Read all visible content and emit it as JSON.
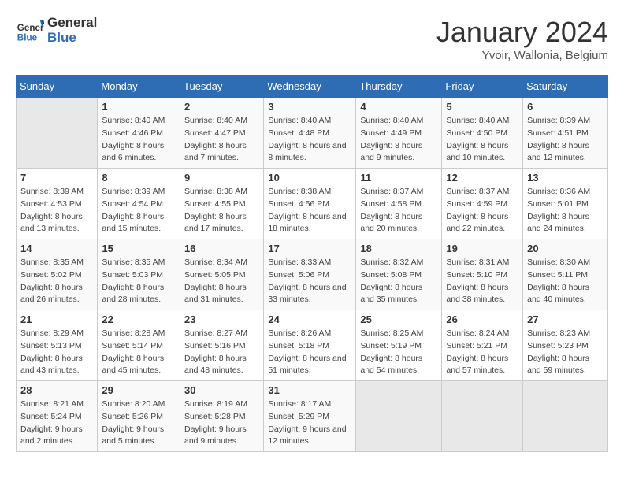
{
  "header": {
    "logo": {
      "general": "General",
      "blue": "Blue"
    },
    "title": "January 2024",
    "subtitle": "Yvoir, Wallonia, Belgium"
  },
  "weekdays": [
    "Sunday",
    "Monday",
    "Tuesday",
    "Wednesday",
    "Thursday",
    "Friday",
    "Saturday"
  ],
  "weeks": [
    [
      {
        "day": "",
        "empty": true
      },
      {
        "day": "1",
        "sunrise": "Sunrise: 8:40 AM",
        "sunset": "Sunset: 4:46 PM",
        "daylight": "Daylight: 8 hours and 6 minutes."
      },
      {
        "day": "2",
        "sunrise": "Sunrise: 8:40 AM",
        "sunset": "Sunset: 4:47 PM",
        "daylight": "Daylight: 8 hours and 7 minutes."
      },
      {
        "day": "3",
        "sunrise": "Sunrise: 8:40 AM",
        "sunset": "Sunset: 4:48 PM",
        "daylight": "Daylight: 8 hours and 8 minutes."
      },
      {
        "day": "4",
        "sunrise": "Sunrise: 8:40 AM",
        "sunset": "Sunset: 4:49 PM",
        "daylight": "Daylight: 8 hours and 9 minutes."
      },
      {
        "day": "5",
        "sunrise": "Sunrise: 8:40 AM",
        "sunset": "Sunset: 4:50 PM",
        "daylight": "Daylight: 8 hours and 10 minutes."
      },
      {
        "day": "6",
        "sunrise": "Sunrise: 8:39 AM",
        "sunset": "Sunset: 4:51 PM",
        "daylight": "Daylight: 8 hours and 12 minutes."
      }
    ],
    [
      {
        "day": "7",
        "sunrise": "Sunrise: 8:39 AM",
        "sunset": "Sunset: 4:53 PM",
        "daylight": "Daylight: 8 hours and 13 minutes."
      },
      {
        "day": "8",
        "sunrise": "Sunrise: 8:39 AM",
        "sunset": "Sunset: 4:54 PM",
        "daylight": "Daylight: 8 hours and 15 minutes."
      },
      {
        "day": "9",
        "sunrise": "Sunrise: 8:38 AM",
        "sunset": "Sunset: 4:55 PM",
        "daylight": "Daylight: 8 hours and 17 minutes."
      },
      {
        "day": "10",
        "sunrise": "Sunrise: 8:38 AM",
        "sunset": "Sunset: 4:56 PM",
        "daylight": "Daylight: 8 hours and 18 minutes."
      },
      {
        "day": "11",
        "sunrise": "Sunrise: 8:37 AM",
        "sunset": "Sunset: 4:58 PM",
        "daylight": "Daylight: 8 hours and 20 minutes."
      },
      {
        "day": "12",
        "sunrise": "Sunrise: 8:37 AM",
        "sunset": "Sunset: 4:59 PM",
        "daylight": "Daylight: 8 hours and 22 minutes."
      },
      {
        "day": "13",
        "sunrise": "Sunrise: 8:36 AM",
        "sunset": "Sunset: 5:01 PM",
        "daylight": "Daylight: 8 hours and 24 minutes."
      }
    ],
    [
      {
        "day": "14",
        "sunrise": "Sunrise: 8:35 AM",
        "sunset": "Sunset: 5:02 PM",
        "daylight": "Daylight: 8 hours and 26 minutes."
      },
      {
        "day": "15",
        "sunrise": "Sunrise: 8:35 AM",
        "sunset": "Sunset: 5:03 PM",
        "daylight": "Daylight: 8 hours and 28 minutes."
      },
      {
        "day": "16",
        "sunrise": "Sunrise: 8:34 AM",
        "sunset": "Sunset: 5:05 PM",
        "daylight": "Daylight: 8 hours and 31 minutes."
      },
      {
        "day": "17",
        "sunrise": "Sunrise: 8:33 AM",
        "sunset": "Sunset: 5:06 PM",
        "daylight": "Daylight: 8 hours and 33 minutes."
      },
      {
        "day": "18",
        "sunrise": "Sunrise: 8:32 AM",
        "sunset": "Sunset: 5:08 PM",
        "daylight": "Daylight: 8 hours and 35 minutes."
      },
      {
        "day": "19",
        "sunrise": "Sunrise: 8:31 AM",
        "sunset": "Sunset: 5:10 PM",
        "daylight": "Daylight: 8 hours and 38 minutes."
      },
      {
        "day": "20",
        "sunrise": "Sunrise: 8:30 AM",
        "sunset": "Sunset: 5:11 PM",
        "daylight": "Daylight: 8 hours and 40 minutes."
      }
    ],
    [
      {
        "day": "21",
        "sunrise": "Sunrise: 8:29 AM",
        "sunset": "Sunset: 5:13 PM",
        "daylight": "Daylight: 8 hours and 43 minutes."
      },
      {
        "day": "22",
        "sunrise": "Sunrise: 8:28 AM",
        "sunset": "Sunset: 5:14 PM",
        "daylight": "Daylight: 8 hours and 45 minutes."
      },
      {
        "day": "23",
        "sunrise": "Sunrise: 8:27 AM",
        "sunset": "Sunset: 5:16 PM",
        "daylight": "Daylight: 8 hours and 48 minutes."
      },
      {
        "day": "24",
        "sunrise": "Sunrise: 8:26 AM",
        "sunset": "Sunset: 5:18 PM",
        "daylight": "Daylight: 8 hours and 51 minutes."
      },
      {
        "day": "25",
        "sunrise": "Sunrise: 8:25 AM",
        "sunset": "Sunset: 5:19 PM",
        "daylight": "Daylight: 8 hours and 54 minutes."
      },
      {
        "day": "26",
        "sunrise": "Sunrise: 8:24 AM",
        "sunset": "Sunset: 5:21 PM",
        "daylight": "Daylight: 8 hours and 57 minutes."
      },
      {
        "day": "27",
        "sunrise": "Sunrise: 8:23 AM",
        "sunset": "Sunset: 5:23 PM",
        "daylight": "Daylight: 8 hours and 59 minutes."
      }
    ],
    [
      {
        "day": "28",
        "sunrise": "Sunrise: 8:21 AM",
        "sunset": "Sunset: 5:24 PM",
        "daylight": "Daylight: 9 hours and 2 minutes."
      },
      {
        "day": "29",
        "sunrise": "Sunrise: 8:20 AM",
        "sunset": "Sunset: 5:26 PM",
        "daylight": "Daylight: 9 hours and 5 minutes."
      },
      {
        "day": "30",
        "sunrise": "Sunrise: 8:19 AM",
        "sunset": "Sunset: 5:28 PM",
        "daylight": "Daylight: 9 hours and 9 minutes."
      },
      {
        "day": "31",
        "sunrise": "Sunrise: 8:17 AM",
        "sunset": "Sunset: 5:29 PM",
        "daylight": "Daylight: 9 hours and 12 minutes."
      },
      {
        "day": "",
        "empty": true
      },
      {
        "day": "",
        "empty": true
      },
      {
        "day": "",
        "empty": true
      }
    ]
  ]
}
